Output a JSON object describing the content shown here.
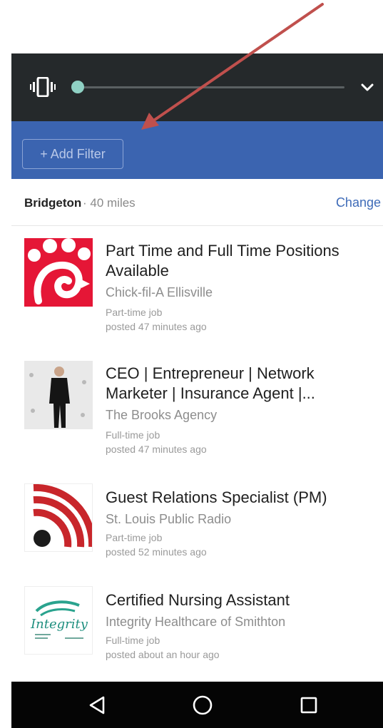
{
  "colors": {
    "topbar": "#25292b",
    "filterbar": "#3b64b0",
    "link": "#3e6bb8",
    "arrow": "#c0504d",
    "navbar": "#050505"
  },
  "topbar": {
    "left_icon": "vibrate-icon",
    "right_icon": "chevron-down-icon"
  },
  "filter": {
    "add_label": "+ Add Filter"
  },
  "location": {
    "city": "Bridgeton",
    "radius": "· 40 miles",
    "change_label": "Change"
  },
  "jobs": [
    {
      "title": "Part Time and Full Time Positions Available",
      "company": "Chick-fil-A Ellisville",
      "type": "Part-time job",
      "posted": "posted 47 minutes ago"
    },
    {
      "title": "CEO | Entrepreneur | Network Marketer | Insurance Agent |...",
      "company": "The Brooks Agency",
      "type": "Full-time job",
      "posted": "posted 47 minutes ago"
    },
    {
      "title": "Guest Relations Specialist (PM)",
      "company": "St. Louis Public Radio",
      "type": "Part-time job",
      "posted": "posted 52 minutes ago"
    },
    {
      "title": "Certified Nursing Assistant",
      "company": "Integrity Healthcare of Smithton",
      "type": "Full-time job",
      "posted": "posted about an hour ago",
      "logo_text": "Integrity"
    }
  ],
  "navbar": {
    "back_icon": "back-triangle-icon",
    "home_icon": "home-circle-icon",
    "recent_icon": "recent-apps-icon"
  }
}
